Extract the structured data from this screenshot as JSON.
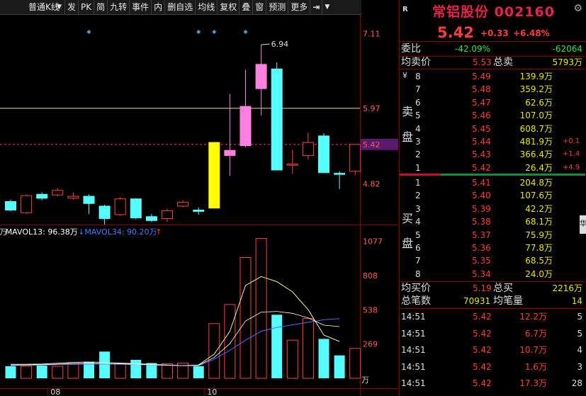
{
  "toolbar": {
    "period_label": "普通K线",
    "buttons": [
      "发",
      "PK",
      "简",
      "九转",
      "事件",
      "内",
      "删自选",
      "均线",
      "复权",
      "叠",
      "窗",
      "预测",
      "更多"
    ]
  },
  "chart_data": {
    "type": "candlestick",
    "price_axis": {
      "min": 4.35,
      "max": 7.2,
      "tick_labels": [
        "7.11",
        "5.97",
        "5.42",
        "4.82"
      ]
    },
    "reference_price": 5.97,
    "current_price": 5.42,
    "high_annotation": "6.94",
    "x_labels": [
      "08",
      "10"
    ],
    "candles": [
      {
        "o": 4.55,
        "c": 4.42,
        "h": 4.58,
        "l": 4.4
      },
      {
        "o": 4.38,
        "c": 4.64,
        "h": 4.66,
        "l": 4.36
      },
      {
        "o": 4.66,
        "c": 4.6,
        "h": 4.69,
        "l": 4.57
      },
      {
        "o": 4.65,
        "c": 4.72,
        "h": 4.75,
        "l": 4.63
      },
      {
        "o": 4.6,
        "c": 4.63,
        "h": 4.69,
        "l": 4.58
      },
      {
        "o": 4.63,
        "c": 4.52,
        "h": 4.66,
        "l": 4.36
      },
      {
        "o": 4.48,
        "c": 4.29,
        "h": 4.5,
        "l": 4.2
      },
      {
        "o": 4.35,
        "c": 4.59,
        "h": 4.62,
        "l": 4.33
      },
      {
        "o": 4.59,
        "c": 4.3,
        "h": 4.6,
        "l": 4.28
      },
      {
        "o": 4.32,
        "c": 4.26,
        "h": 4.36,
        "l": 4.24
      },
      {
        "o": 4.29,
        "c": 4.41,
        "h": 4.44,
        "l": 4.24
      },
      {
        "o": 4.48,
        "c": 4.54,
        "h": 4.57,
        "l": 4.46
      },
      {
        "o": 4.42,
        "c": 4.4,
        "h": 4.46,
        "l": 4.35
      },
      {
        "o": 4.45,
        "c": 5.45,
        "h": 5.45,
        "l": 4.45
      },
      {
        "o": 5.25,
        "c": 5.33,
        "h": 6.19,
        "l": 4.94
      },
      {
        "o": 5.4,
        "c": 6.0,
        "h": 6.56,
        "l": 5.38
      },
      {
        "o": 6.27,
        "c": 6.64,
        "h": 6.94,
        "l": 5.86
      },
      {
        "o": 6.57,
        "c": 5.03,
        "h": 6.67,
        "l": 5.03
      },
      {
        "o": 5.11,
        "c": 5.12,
        "h": 5.34,
        "l": 4.97
      },
      {
        "o": 5.25,
        "c": 5.45,
        "h": 5.6,
        "l": 5.19
      },
      {
        "o": 5.55,
        "c": 4.99,
        "h": 5.59,
        "l": 4.99
      },
      {
        "o": 4.98,
        "c": 4.97,
        "h": 5.01,
        "l": 4.74
      },
      {
        "o": 5.01,
        "c": 5.42,
        "h": 5.42,
        "l": 4.95
      }
    ],
    "volume": {
      "legend": [
        {
          "text": "万",
          "color": "#dddddd"
        },
        {
          "text": "MAVOL13: 96.38万",
          "color": "#ffffff"
        },
        {
          "text": "↓MAVOL34: 90.20万",
          "color": "#4a7bff"
        },
        {
          "text": "↑",
          "color": "#ff3b3b"
        }
      ],
      "axis": {
        "min": 0,
        "max": 1120,
        "tick_labels": [
          "1077",
          "808",
          "538",
          "269"
        ],
        "unit": "万"
      },
      "values": [
        95,
        95,
        100,
        95,
        125,
        130,
        210,
        115,
        145,
        120,
        115,
        120,
        95,
        430,
        580,
        950,
        1100,
        500,
        300,
        470,
        310,
        180,
        235
      ],
      "ma13": [
        110,
        110,
        112,
        118,
        125,
        128,
        125,
        120,
        115,
        110,
        105,
        100,
        105,
        190,
        370,
        730,
        800,
        760,
        680,
        540,
        340,
        290
      ],
      "ma34": [
        100,
        103,
        105,
        108,
        110,
        112,
        112,
        110,
        108,
        105,
        102,
        100,
        100,
        150,
        220,
        300,
        370,
        400,
        420,
        440,
        460,
        470
      ]
    }
  },
  "quote": {
    "r_icon": "R",
    "name": "常铝股份",
    "code": "002160",
    "price": "5.42",
    "change": "+0.33",
    "change_pct": "+6.48%",
    "webi_label": "委比",
    "webi_value": "-42.09%",
    "webi_diff": "-62064",
    "avg_sell_label": "均卖价",
    "avg_sell_value": "5.53",
    "total_sell_label": "总卖",
    "total_sell_value": "5793万",
    "currency": "¥",
    "sell_side_label": [
      "卖",
      "盘"
    ],
    "sell_levels": [
      {
        "level": "8",
        "price": "5.49",
        "vol": "139.9万",
        "delta": ""
      },
      {
        "level": "7",
        "price": "5.48",
        "vol": "359.2万",
        "delta": ""
      },
      {
        "level": "6",
        "price": "5.47",
        "vol": "62.6万",
        "delta": ""
      },
      {
        "level": "5",
        "price": "5.46",
        "vol": "107.0万",
        "delta": ""
      },
      {
        "level": "4",
        "price": "5.45",
        "vol": "608.7万",
        "delta": ""
      },
      {
        "level": "3",
        "price": "5.44",
        "vol": "481.9万",
        "delta": "+0.1"
      },
      {
        "level": "2",
        "price": "5.43",
        "vol": "366.4万",
        "delta": "+1.4"
      },
      {
        "level": "1",
        "price": "5.42",
        "vol": "26.4万",
        "delta": "+4.9"
      }
    ],
    "buy_side_label": [
      "买",
      "盘"
    ],
    "buy_levels": [
      {
        "level": "1",
        "price": "5.41",
        "vol": "204.8万"
      },
      {
        "level": "2",
        "price": "5.40",
        "vol": "107.6万"
      },
      {
        "level": "3",
        "price": "5.39",
        "vol": "42.2万"
      },
      {
        "level": "4",
        "price": "5.38",
        "vol": "68.1万"
      },
      {
        "level": "5",
        "price": "5.37",
        "vol": "75.9万"
      },
      {
        "level": "6",
        "price": "5.36",
        "vol": "77.8万"
      },
      {
        "level": "7",
        "price": "5.35",
        "vol": "68.5万"
      },
      {
        "level": "8",
        "price": "5.34",
        "vol": "24.0万"
      }
    ],
    "avg_buy_label": "均买价",
    "avg_buy_value": "5.19",
    "total_buy_label": "总买",
    "total_buy_value": "2216万",
    "total_trades_label": "总笔数",
    "total_trades_value": "70931",
    "avg_trade_label": "均笔量",
    "avg_trade_value": "14",
    "side_tab": "华",
    "ticks": [
      {
        "time": "14:51",
        "price": "5.42",
        "vol": "12.2万",
        "count": "5"
      },
      {
        "time": "14:51",
        "price": "5.42",
        "vol": "6.7万",
        "count": "5"
      },
      {
        "time": "14:51",
        "price": "5.42",
        "vol": "10.7万",
        "count": "4"
      },
      {
        "time": "14:51",
        "price": "5.42",
        "vol": "1.6万",
        "count": "3"
      },
      {
        "time": "14:51",
        "price": "5.42",
        "vol": "17.3万",
        "count": "28"
      }
    ]
  }
}
